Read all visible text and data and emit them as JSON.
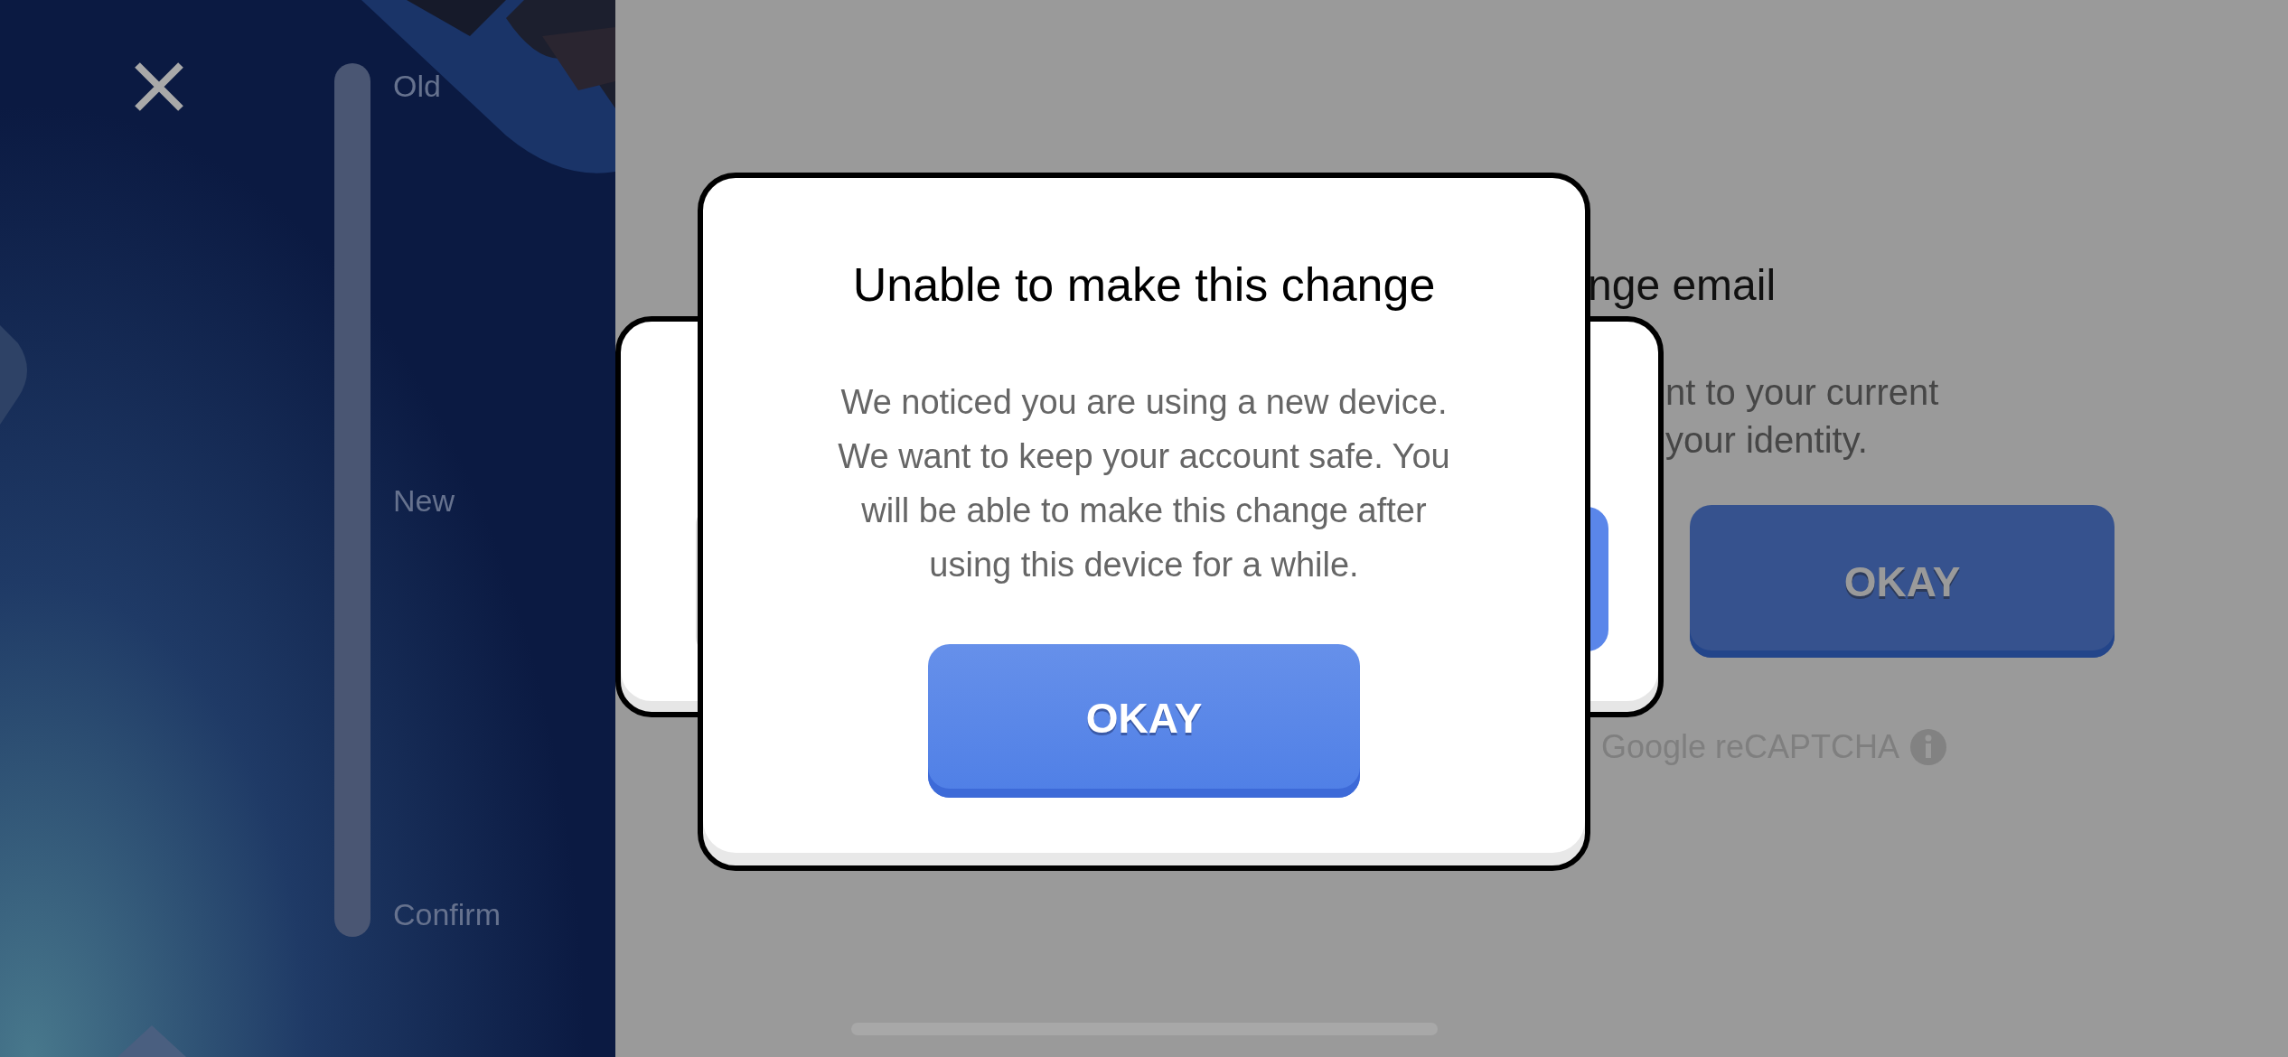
{
  "sidebar": {
    "steps": [
      {
        "label": "Old"
      },
      {
        "label": "New"
      },
      {
        "label": "Confirm"
      }
    ]
  },
  "background_page": {
    "title": "nge email",
    "description": [
      "nt to your current",
      "your identity."
    ],
    "button": "OKAY",
    "recaptcha": "Google reCAPTCHA"
  },
  "dialog": {
    "title": "Unable to make this change",
    "message": [
      "We noticed you are using a new device.",
      "We want to keep your account safe. You",
      "will be able to make this change after",
      "using this device for a while."
    ],
    "button": "OKAY"
  }
}
